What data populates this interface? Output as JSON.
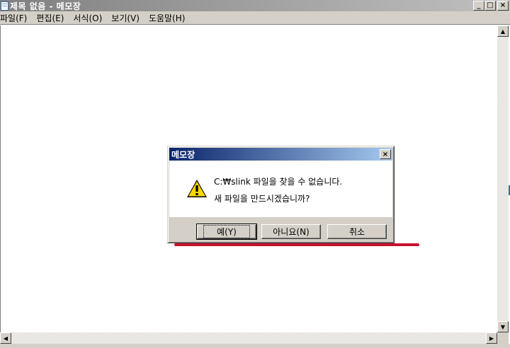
{
  "window": {
    "title": "제목 없음 - 메모장",
    "buttons": {
      "minimize": "_",
      "maximize": "□",
      "close": "×"
    }
  },
  "menu": {
    "items": [
      {
        "label": "파일(F)"
      },
      {
        "label": "편집(E)"
      },
      {
        "label": "서식(O)"
      },
      {
        "label": "보기(V)"
      },
      {
        "label": "도움말(H)"
      }
    ]
  },
  "scrollbars": {
    "up": "▲",
    "down": "▼",
    "left": "◀",
    "right": "▶"
  },
  "dialog": {
    "title": "메모장",
    "close_glyph": "×",
    "icon": "warning-icon",
    "message_line1": "C:₩slink 파일을 찾을 수 없습니다.",
    "message_line2": "새 파일을 만드시겠습니까?",
    "buttons": {
      "yes": "예(Y)",
      "no": "아니요(N)",
      "cancel": "취소"
    }
  },
  "colors": {
    "title_inactive": "#808080",
    "dialog_title": "#0a246a",
    "chrome": "#d4d0c8",
    "annotation": "#c8102e"
  }
}
